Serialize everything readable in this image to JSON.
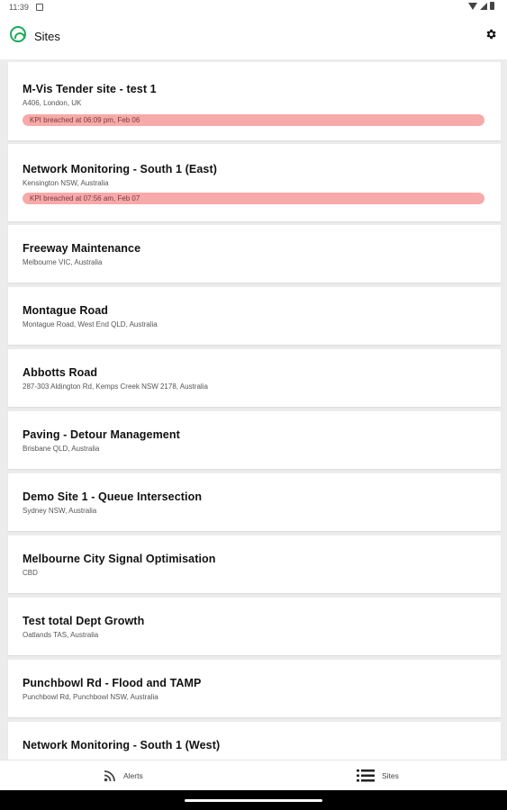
{
  "status_bar": {
    "time": "11:39"
  },
  "app_bar": {
    "title": "Sites"
  },
  "sites": [
    {
      "name": "M-Vis Tender site - test 1",
      "address": "A406, London, UK",
      "kpi": "KPI breached at 06:09 pm, Feb 06"
    },
    {
      "name": "Network Monitoring - South 1 (East)",
      "address": "Kensington NSW, Australia",
      "kpi": "KPI breached at 07:56 am, Feb 07"
    },
    {
      "name": "Freeway Maintenance",
      "address": "Melbourne VIC, Australia"
    },
    {
      "name": "Montague Road",
      "address": "Montague Road, West End QLD, Australia"
    },
    {
      "name": "Abbotts Road",
      "address": "287-303 Aldington Rd, Kemps Creek NSW 2178, Australia"
    },
    {
      "name": "Paving - Detour Management",
      "address": "Brisbane QLD, Australia"
    },
    {
      "name": "Demo Site 1 - Queue Intersection",
      "address": "Sydney NSW, Australia"
    },
    {
      "name": "Melbourne City Signal Optimisation",
      "address": "CBD"
    },
    {
      "name": "Test total Dept Growth",
      "address": "Oatlands TAS, Australia"
    },
    {
      "name": "Punchbowl Rd - Flood and TAMP",
      "address": "Punchbowl Rd, Punchbowl NSW, Australia"
    },
    {
      "name": "Network Monitoring - South 1 (West)",
      "address": ""
    }
  ],
  "bottom_nav": {
    "alerts_label": "Alerts",
    "sites_label": "Sites"
  },
  "colors": {
    "brand": "#1aab5a",
    "kpi_alert": "#f8a9a9"
  },
  "icons": [
    "notification-icon",
    "wifi-icon",
    "signal-icon",
    "battery-icon",
    "app-logo-icon",
    "gear-icon",
    "rss-icon",
    "list-icon"
  ]
}
